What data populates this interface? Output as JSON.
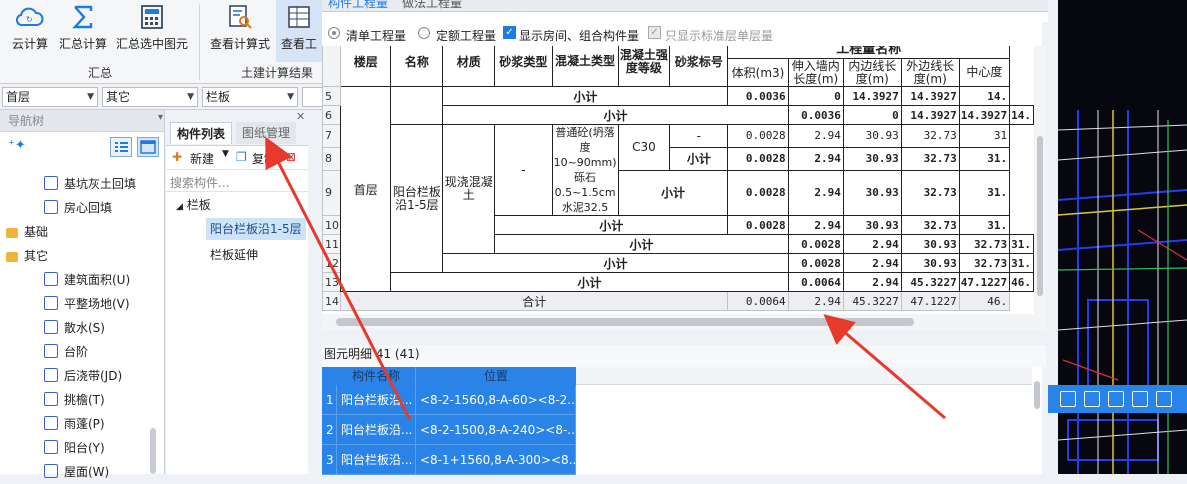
{
  "ribbon": {
    "buttons": [
      {
        "label": "云计算",
        "icon": "cloud-icon"
      },
      {
        "label": "汇总计算",
        "icon": "sigma-icon"
      },
      {
        "label": "汇总选中图元",
        "icon": "calculator-icon"
      },
      {
        "label": "查看计算式",
        "icon": "formula-search-icon"
      },
      {
        "label": "查看工",
        "icon": "table-icon"
      }
    ],
    "group_summary": "汇总",
    "group_civil": "土建计算结果"
  },
  "dropdowns": {
    "floor": "首层",
    "category": "其它",
    "type": "栏板"
  },
  "nav": {
    "header": "导航树",
    "items": [
      {
        "label": "基坑灰土回填",
        "icon": "pit-backfill-icon",
        "level": 2
      },
      {
        "label": "房心回填",
        "icon": "room-backfill-icon",
        "level": 2
      },
      {
        "label": "基础",
        "icon": "folder-icon",
        "level": 1
      },
      {
        "label": "其它",
        "icon": "folder-icon",
        "level": 1
      },
      {
        "label": "建筑面积(U)",
        "icon": "building-area-icon",
        "level": 2
      },
      {
        "label": "平整场地(V)",
        "icon": "site-leveling-icon",
        "level": 2
      },
      {
        "label": "散水(S)",
        "icon": "apron-icon",
        "level": 2
      },
      {
        "label": "台阶",
        "icon": "steps-icon",
        "level": 2
      },
      {
        "label": "后浇带(JD)",
        "icon": "post-cast-strip-icon",
        "level": 2
      },
      {
        "label": "挑檐(T)",
        "icon": "eave-icon",
        "level": 2
      },
      {
        "label": "雨蓬(P)",
        "icon": "canopy-icon",
        "level": 2
      },
      {
        "label": "阳台(Y)",
        "icon": "balcony-icon",
        "level": 2
      },
      {
        "label": "屋面(W)",
        "icon": "roof-icon",
        "level": 2
      }
    ]
  },
  "comp": {
    "tab_list": "构件列表",
    "tab_drawing": "图纸管理",
    "new_label": "新建",
    "copy_label": "复制",
    "search_placeholder": "搜索构件...",
    "group": "栏板",
    "items": [
      "阳台栏板沿1-5层",
      "栏板延伸"
    ]
  },
  "tabs": {
    "t1": "构件工程量",
    "t2": "做法工程量"
  },
  "options": {
    "r1": "清单工程量",
    "r2": "定额工程量",
    "c1": "显示房间、组合构件量",
    "c2": "只显示标准层单层量"
  },
  "table": {
    "header": {
      "floor": "楼层",
      "name": "名称",
      "material": "材质",
      "mortar_type": "砂浆类型",
      "concrete_type": "混凝土类型",
      "concrete_grade": "混凝土强度等级",
      "mortar_grade": "砂浆标号",
      "qty_name": "工程量名称",
      "volume": "体积(m3)",
      "embed_len": "伸入墙内长度(m)",
      "inner_len": "内边线长度(m)",
      "outer_len": "外边线长度(m)",
      "center_len": "中心度"
    },
    "row_nums": [
      "5",
      "6",
      "7",
      "8",
      "9",
      "10",
      "11",
      "12",
      "13",
      "14"
    ],
    "floor_val": "首层",
    "name_val": "阳台栏板沿1-5层",
    "material_val": "现浇混凝土",
    "mortar_type_val": "-",
    "concrete_type_val": "普通砼(坍落度10~90mm) 砾石0.5~1.5cm 水泥32.5",
    "grade_val": "C30",
    "mortar_grade_val": "-",
    "subtotal": "小计",
    "total": "合计",
    "r5": [
      "0.0036",
      "0",
      "14.3927",
      "14.3927",
      "14."
    ],
    "r6": [
      "0.0036",
      "0",
      "14.3927",
      "14.3927",
      "14."
    ],
    "r7": [
      "0.0028",
      "2.94",
      "30.93",
      "32.73",
      "31"
    ],
    "r8": [
      "0.0028",
      "2.94",
      "30.93",
      "32.73",
      "31."
    ],
    "r9": [
      "0.0028",
      "2.94",
      "30.93",
      "32.73",
      "31."
    ],
    "r10": [
      "0.0028",
      "2.94",
      "30.93",
      "32.73",
      "31."
    ],
    "r11": [
      "0.0028",
      "2.94",
      "30.93",
      "32.73",
      "31."
    ],
    "r12": [
      "0.0028",
      "2.94",
      "30.93",
      "32.73",
      "31."
    ],
    "r13": [
      "0.0064",
      "2.94",
      "45.3227",
      "47.1227",
      "46."
    ],
    "r14": [
      "0.0064",
      "2.94",
      "45.3227",
      "47.1227",
      "46."
    ]
  },
  "detail": {
    "title": "图元明细",
    "count": "41 (41)",
    "col_name": "构件名称",
    "col_pos": "位置",
    "rows": [
      {
        "n": "1",
        "name": "阳台栏板沿...",
        "pos": "<8-2-1560,8-A-60><8-2..."
      },
      {
        "n": "2",
        "name": "阳台栏板沿...",
        "pos": "<8-2-1500,8-A-240><8-..."
      },
      {
        "n": "3",
        "name": "阳台栏板沿...",
        "pos": "<8-1+1560,8-A-300><8..."
      }
    ]
  },
  "colors": {
    "accent": "#2a83e6",
    "selection": "#cde3f7",
    "arrow": "#e8392d"
  }
}
